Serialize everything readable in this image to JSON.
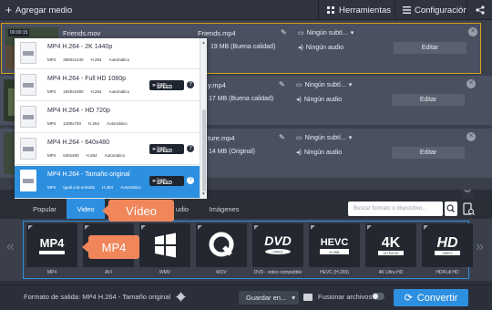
{
  "toolbar": {
    "add_media": "Agregar medio",
    "tools": "Herramientas",
    "settings": "Configuración"
  },
  "files": [
    {
      "name": "Friends.mov",
      "output_name": "Friends.mp4",
      "size": "19 MB (Buena calidad)",
      "subtitles": "Ningún subtí...",
      "audio": "Ningún audio",
      "edit": "Editar",
      "timestamp": "00:00:15"
    },
    {
      "name": "",
      "output_name": "y.mp4",
      "size": "17 MB (Buena calidad)",
      "subtitles": "Ningún subtí...",
      "audio": "Ningún audio",
      "edit": "Editar"
    },
    {
      "name": "",
      "output_name": "ture.mp4",
      "size": "14 MB (Original)",
      "subtitles": "Ningún subtí...",
      "audio": "Ningún audio",
      "edit": "Editar"
    }
  ],
  "dropdown": {
    "items": [
      {
        "title": "MP4 H.264 - 2K 1440p",
        "meta": [
          "MP4",
          "2560x1440",
          "H.264",
          "Automático"
        ],
        "speed": false,
        "selected": false
      },
      {
        "title": "MP4 H.264 - Full HD 1080p",
        "meta": [
          "MP4",
          "1920x1080",
          "H.264",
          "Automático"
        ],
        "speed": true,
        "selected": false
      },
      {
        "title": "MP4 H.264 - HD 720p",
        "meta": [
          "MP4",
          "1280x720",
          "H.264",
          "Automático"
        ],
        "speed": false,
        "selected": false
      },
      {
        "title": "MP4 H.264 - 640x480",
        "meta": [
          "MP4",
          "640x480",
          "H.264",
          "Automático"
        ],
        "speed": true,
        "selected": false
      },
      {
        "title": "MP4 H.264 - Tamaño original",
        "meta": [
          "MP4",
          "Igual a la entrada",
          "H.264",
          "Automático"
        ],
        "speed": true,
        "selected": true
      }
    ],
    "speed_line1": "Super",
    "speed_line2": "SPEED"
  },
  "format_tabs": [
    {
      "label": "Popular",
      "active": false
    },
    {
      "label": "Video",
      "active": true
    },
    {
      "label": "udio",
      "active": false
    },
    {
      "label": "Imágenes",
      "active": false
    }
  ],
  "search_placeholder": "Buscar formato o dispositivo...",
  "formats": [
    {
      "name": "MP4",
      "label": "MP4"
    },
    {
      "name": "AVI",
      "label": "AVI"
    },
    {
      "name": "WMV",
      "label": "WMV"
    },
    {
      "name": "MOV",
      "label": "MOV"
    },
    {
      "name": "DVD",
      "label": "DVD - video compatible"
    },
    {
      "name": "HEVC",
      "label": "HEVC (H.265)"
    },
    {
      "name": "4K",
      "label": "4K Ultra HD"
    },
    {
      "name": "HD",
      "label": "HD/Full HD"
    }
  ],
  "callouts": {
    "video": "Vídeo",
    "mp4": "MP4"
  },
  "bottom": {
    "output_format": "Formato de salida: MP4 H.264 - Tamaño original",
    "save_to": "Guardar en...",
    "merge": "Fusionar archivos",
    "convert": "Convertir"
  },
  "colors": {
    "accent": "#2d8fe0",
    "callout": "#f0865a",
    "highlight_border": "#d4a21a"
  }
}
